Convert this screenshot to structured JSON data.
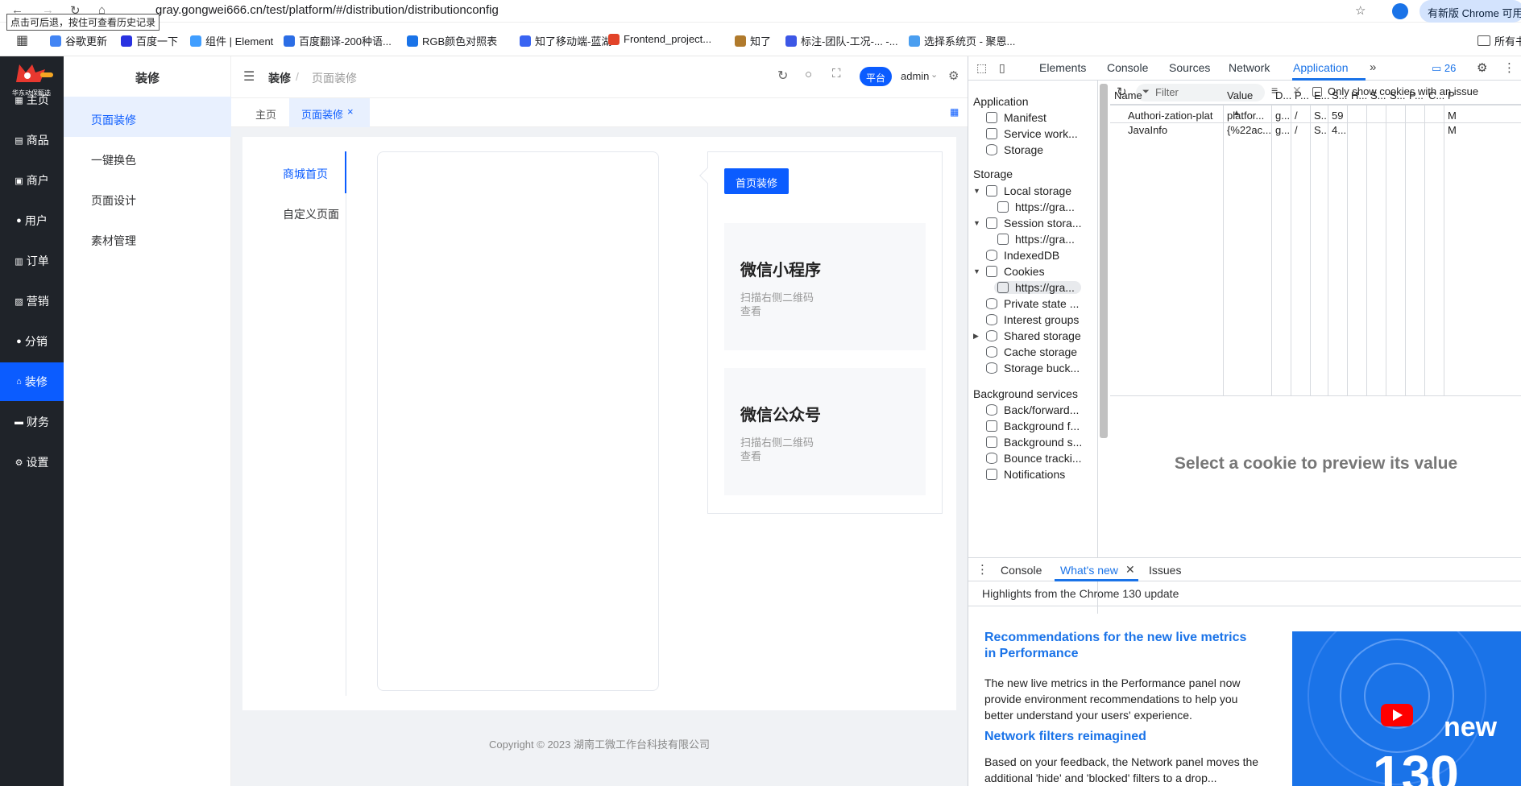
{
  "browser": {
    "url": "gray.gongwei666.cn/test/platform/#/distribution/distributionconfig",
    "tooltip": "点击可后退，按住可查看历史记录",
    "update_button": "有新版 Chrome 可用",
    "bookmarks": [
      {
        "label": "谷歌更新",
        "color": "#4285f4"
      },
      {
        "label": "百度一下",
        "color": "#2932e1"
      },
      {
        "label": "组件 | Element",
        "color": "#409eff"
      },
      {
        "label": "百度翻译-200种语...",
        "color": "#2b6de5"
      },
      {
        "label": "RGB颜色对照表",
        "color": "#1a73e8"
      },
      {
        "label": "知了移动端-蓝湖",
        "color": "#3964f2"
      },
      {
        "label": "Frontend_project...",
        "color": "#e24329"
      },
      {
        "label": "知了",
        "color": "#b07a2c"
      },
      {
        "label": "标注-团队-工况-... -...",
        "color": "#3c57e6"
      },
      {
        "label": "选择系统页 - 聚恩...",
        "color": "#4a9ef0"
      }
    ],
    "bookmarks_folder": "所有书"
  },
  "app": {
    "logo_text": "华东动保甄选",
    "main_nav": [
      {
        "label": "主页",
        "icon": "grid-icon"
      },
      {
        "label": "商品",
        "icon": "bag-icon"
      },
      {
        "label": "商户",
        "icon": "shop-icon"
      },
      {
        "label": "用户",
        "icon": "user-icon"
      },
      {
        "label": "订单",
        "icon": "order-icon"
      },
      {
        "label": "营销",
        "icon": "chart-icon"
      },
      {
        "label": "分销",
        "icon": "user-icon"
      },
      {
        "label": "装修",
        "icon": "home-icon"
      },
      {
        "label": "财务",
        "icon": "wallet-icon"
      },
      {
        "label": "设置",
        "icon": "gear-icon"
      }
    ],
    "active_nav": 7,
    "sub_title": "装修",
    "sub_nav": [
      "页面装修",
      "一键换色",
      "页面设计",
      "素材管理"
    ],
    "breadcrumb": {
      "root": "装修",
      "sep": "/",
      "current": "页面装修"
    },
    "header_right": {
      "platform": "平台",
      "user": "admin"
    },
    "tabs": [
      {
        "label": "主页"
      },
      {
        "label": "页面装修",
        "close": "×"
      }
    ],
    "page_tabs": [
      "商城首页",
      "自定义页面"
    ],
    "edit_button": "首页装修",
    "cards": [
      {
        "title": "微信小程序",
        "desc": "扫描右侧二维码查看"
      },
      {
        "title": "微信公众号",
        "desc": "扫描右侧二维码查看"
      }
    ],
    "copyright": "Copyright © 2023 湖南工微工作台科技有限公司"
  },
  "devtools": {
    "tabs": [
      "Elements",
      "Console",
      "Sources",
      "Network",
      "Application"
    ],
    "active_tab": "Application",
    "issue_count": "26",
    "filter_placeholder": "Filter",
    "only_issue_label": "Only show cookies with an issue",
    "tree": {
      "application_header": "Application",
      "application_items": [
        "Manifest",
        "Service work...",
        "Storage"
      ],
      "storage_header": "Storage",
      "storage_items": [
        "Local storage",
        "https://gra...",
        "Session stora...",
        "https://gra...",
        "IndexedDB",
        "Cookies",
        "https://gra...",
        "Private state ...",
        "Interest groups",
        "Shared storage",
        "Cache storage",
        "Storage buck..."
      ],
      "background_header": "Background services",
      "background_items": [
        "Back/forward...",
        "Background f...",
        "Background s...",
        "Bounce tracki...",
        "Notifications"
      ]
    },
    "table_headers": [
      "Name",
      "Value",
      "D...",
      "P...",
      "E...",
      "S...",
      "H...",
      "S...",
      "S...",
      "P...",
      "C...",
      "P"
    ],
    "rows": [
      [
        "Authori-zation-plat",
        "platfor...",
        "g...",
        "/",
        "S...",
        "59",
        "",
        "",
        "",
        "",
        "",
        "M"
      ],
      [
        "JavaInfo",
        "{%22ac...",
        "g...",
        "/",
        "S...",
        "4...",
        "",
        "",
        "",
        "",
        "",
        "M"
      ]
    ],
    "preview_text": "Select a cookie to preview its value",
    "drawer_tabs": [
      "Console",
      "What's new",
      "Issues"
    ],
    "drawer_active": "What's new",
    "whats_new_heading": "Highlights from the Chrome 130 update",
    "articles": [
      {
        "title": "Recommendations for the new live metrics in Performance",
        "body": "The new live metrics in the Performance panel now provide environment recommendations to help you better understand your users' experience."
      },
      {
        "title": "Network filters reimagined",
        "body": "Based on your feedback, the Network panel moves the additional 'hide' and 'blocked' filters to a drop..."
      }
    ],
    "promo_text": "new",
    "promo_number": "130"
  }
}
